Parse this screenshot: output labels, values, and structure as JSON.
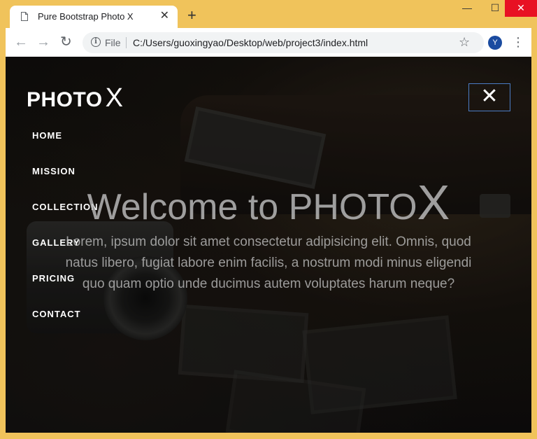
{
  "browser": {
    "tab_title": "Pure Bootstrap Photo X",
    "tab_close": "✕",
    "new_tab": "+",
    "file_label": "File",
    "url": "C:/Users/guoxingyao/Desktop/web/project3/index.html",
    "profile_initial": "Y",
    "win_min": "—",
    "win_max": "☐",
    "win_close": "✕",
    "icons": {
      "back": "back-arrow-icon",
      "forward": "forward-arrow-icon",
      "reload": "reload-icon",
      "info": "info-icon",
      "star": "star-icon",
      "menu": "kebab-menu-icon",
      "tab_doc": "document-icon"
    }
  },
  "page": {
    "brand_photo": "PHOTO",
    "brand_x": "X",
    "close_label": "✕",
    "nav": [
      {
        "label": "HOME"
      },
      {
        "label": "MISSION"
      },
      {
        "label": "COLLECTION"
      },
      {
        "label": "GALLERY"
      },
      {
        "label": "PRICING"
      },
      {
        "label": "CONTACT"
      }
    ],
    "hero_title_prefix": "Welcome to PHOTO",
    "hero_title_x": "X",
    "hero_text": "Lorem, ipsum dolor sit amet consectetur adipisicing elit. Omnis, quod natus libero, fugiat labore enim facilis, a nostrum modi minus eligendi quo quam optio unde ducimus autem voluptates harum neque?"
  },
  "colors": {
    "window_frame": "#f0c35b",
    "close_border": "#4b7cc5",
    "win_close_bg": "#e81123"
  }
}
